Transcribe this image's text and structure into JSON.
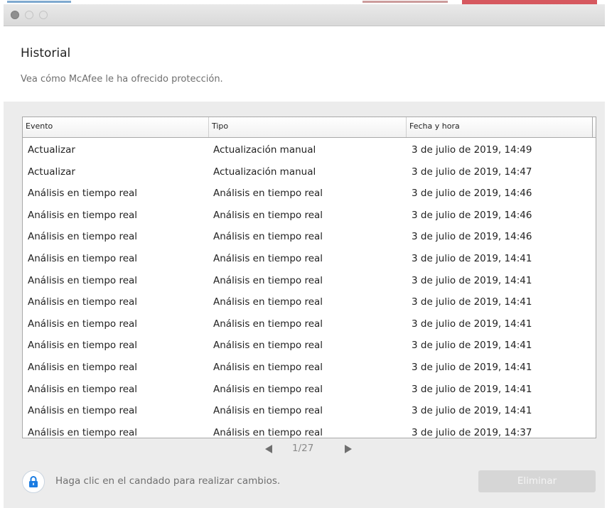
{
  "window": {
    "title": "Historial",
    "subtitle": "Vea cómo McAfee le ha ofrecido protección."
  },
  "table": {
    "columns": [
      "Evento",
      "Tipo",
      "Fecha y hora"
    ],
    "rows": [
      [
        "Actualizar",
        "Actualización manual",
        "3 de julio de 2019, 14:49"
      ],
      [
        "Actualizar",
        "Actualización manual",
        "3 de julio de 2019, 14:47"
      ],
      [
        "Análisis en tiempo real",
        "Análisis en tiempo real",
        "3 de julio de 2019, 14:46"
      ],
      [
        "Análisis en tiempo real",
        "Análisis en tiempo real",
        "3 de julio de 2019, 14:46"
      ],
      [
        "Análisis en tiempo real",
        "Análisis en tiempo real",
        "3 de julio de 2019, 14:46"
      ],
      [
        "Análisis en tiempo real",
        "Análisis en tiempo real",
        "3 de julio de 2019, 14:41"
      ],
      [
        "Análisis en tiempo real",
        "Análisis en tiempo real",
        "3 de julio de 2019, 14:41"
      ],
      [
        "Análisis en tiempo real",
        "Análisis en tiempo real",
        "3 de julio de 2019, 14:41"
      ],
      [
        "Análisis en tiempo real",
        "Análisis en tiempo real",
        "3 de julio de 2019, 14:41"
      ],
      [
        "Análisis en tiempo real",
        "Análisis en tiempo real",
        "3 de julio de 2019, 14:41"
      ],
      [
        "Análisis en tiempo real",
        "Análisis en tiempo real",
        "3 de julio de 2019, 14:41"
      ],
      [
        "Análisis en tiempo real",
        "Análisis en tiempo real",
        "3 de julio de 2019, 14:41"
      ],
      [
        "Análisis en tiempo real",
        "Análisis en tiempo real",
        "3 de julio de 2019, 14:41"
      ],
      [
        "Análisis en tiempo real",
        "Análisis en tiempo real",
        "3 de julio de 2019, 14:37"
      ]
    ]
  },
  "pagination": {
    "label": "1/27",
    "prev_icon": "triangle-left",
    "next_icon": "triangle-right"
  },
  "footer": {
    "lock_text": "Haga clic en el candado para realizar cambios.",
    "lock_icon": "lock",
    "delete_label": "Eliminar"
  },
  "colors": {
    "lock_accent": "#1a7ce2",
    "button_disabled": "#d6d6d6"
  }
}
